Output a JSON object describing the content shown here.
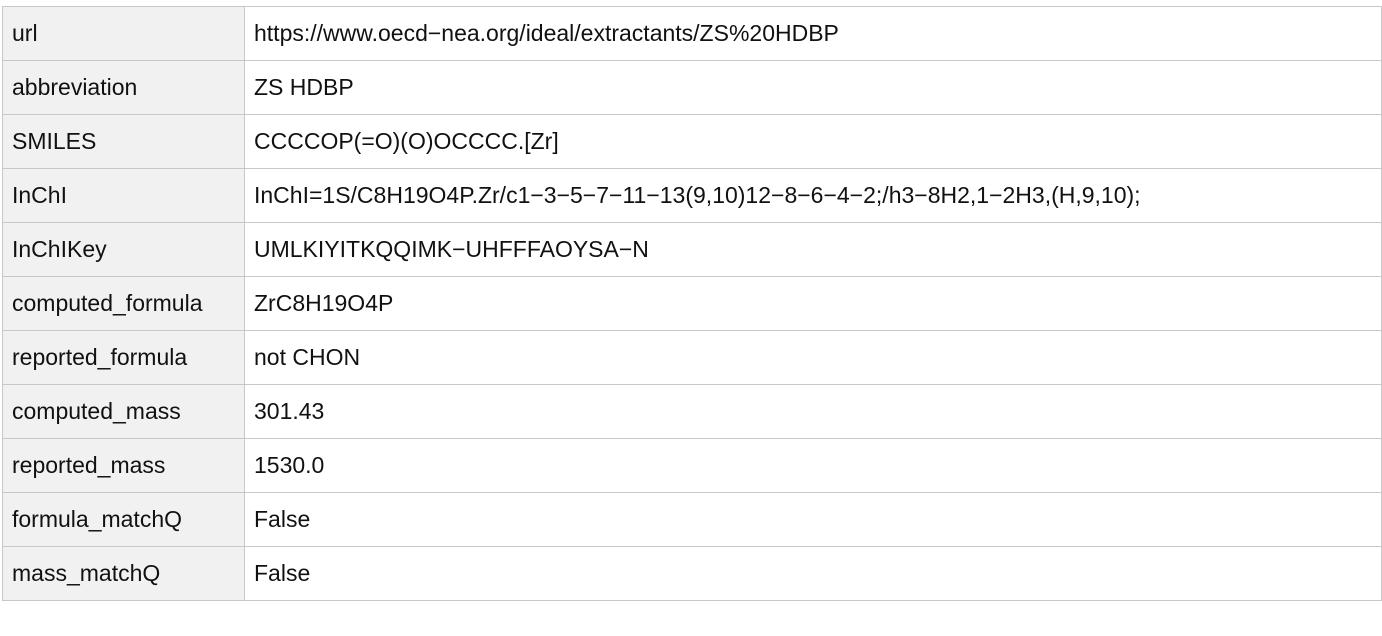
{
  "properties": [
    {
      "key": "url",
      "value": "https://www.oecd−nea.org/ideal/extractants/ZS%20HDBP"
    },
    {
      "key": "abbreviation",
      "value": "ZS HDBP"
    },
    {
      "key": "SMILES",
      "value": "CCCCOP(=O)(O)OCCCC.[Zr]"
    },
    {
      "key": "InChI",
      "value": "InChI=1S/C8H19O4P.Zr/c1−3−5−7−11−13(9,10)12−8−6−4−2;/h3−8H2,1−2H3,(H,9,10);"
    },
    {
      "key": "InChIKey",
      "value": "UMLKIYITKQQIMK−UHFFFAOYSA−N"
    },
    {
      "key": "computed_formula",
      "value": "ZrC8H19O4P"
    },
    {
      "key": "reported_formula",
      "value": "not CHON"
    },
    {
      "key": "computed_mass",
      "value": "301.43"
    },
    {
      "key": "reported_mass",
      "value": "1530.0"
    },
    {
      "key": "formula_matchQ",
      "value": "False"
    },
    {
      "key": "mass_matchQ",
      "value": "False"
    }
  ]
}
